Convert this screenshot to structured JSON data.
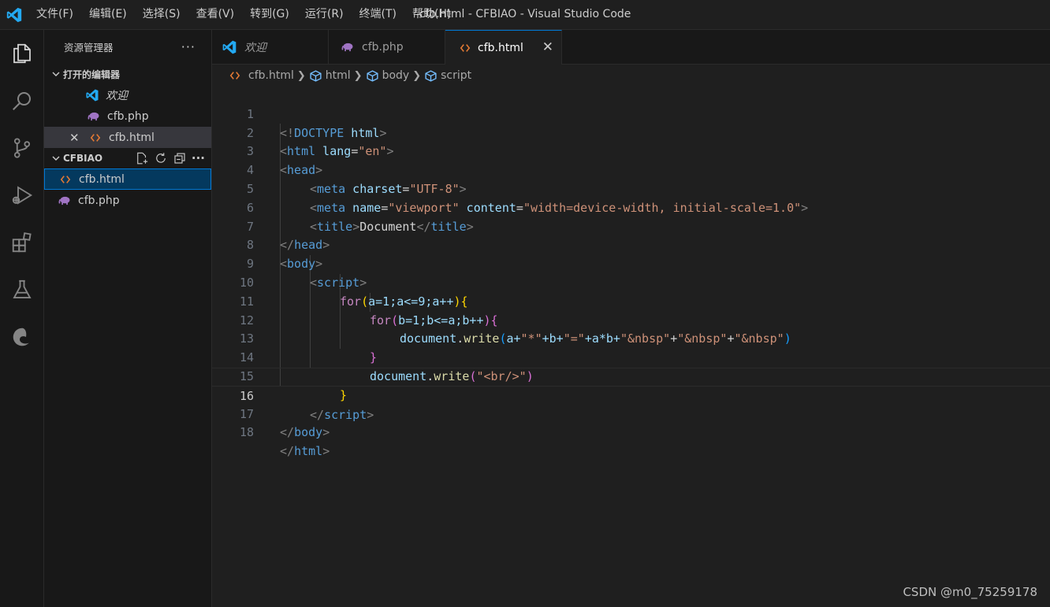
{
  "menu": [
    "文件(F)",
    "编辑(E)",
    "选择(S)",
    "查看(V)",
    "转到(G)",
    "运行(R)",
    "终端(T)",
    "帮助(H)"
  ],
  "window_title": "cfb.html - CFBIAO - Visual Studio Code",
  "sidebar": {
    "title": "资源管理器",
    "more": "···",
    "open_editors": {
      "label": "打开的编辑器",
      "items": [
        "欢迎",
        "cfb.php",
        "cfb.html"
      ]
    },
    "folder": {
      "label": "CFBIAO",
      "items": [
        "cfb.html",
        "cfb.php"
      ]
    }
  },
  "tabs": [
    "欢迎",
    "cfb.php",
    "cfb.html"
  ],
  "breadcrumb": [
    "cfb.html",
    "html",
    "body",
    "script"
  ],
  "line_numbers": [
    "1",
    "2",
    "3",
    "4",
    "5",
    "6",
    "7",
    "8",
    "9",
    "10",
    "11",
    "12",
    "13",
    "14",
    "15",
    "16",
    "17",
    "18"
  ],
  "code": {
    "l1": {
      "a": "<!",
      "b": "DOCTYPE",
      "c": " html",
      "d": ">"
    },
    "l2": {
      "a": "<",
      "b": "html",
      "c": " lang",
      "d": "=",
      "e": "\"en\"",
      "f": ">"
    },
    "l3": {
      "a": "<",
      "b": "head",
      "c": ">"
    },
    "l4": {
      "a": "<",
      "b": "meta",
      "c": " charset",
      "d": "=",
      "e": "\"UTF-8\"",
      "f": ">"
    },
    "l5": {
      "a": "<",
      "b": "meta",
      "c": " name",
      "d": "=",
      "e": "\"viewport\"",
      "f": " content",
      "g": "=",
      "h": "\"width=device-width, initial-scale=1.0\"",
      "i": ">"
    },
    "l6": {
      "a": "<",
      "b": "title",
      "c": ">",
      "d": "Document",
      "e": "</",
      "f": "title",
      "g": ">"
    },
    "l7": {
      "a": "</",
      "b": "head",
      "c": ">"
    },
    "l8": {
      "a": "<",
      "b": "body",
      "c": ">"
    },
    "l9": {
      "a": "<",
      "b": "script",
      "c": ">"
    },
    "l10": {
      "a": "for",
      "b": "(",
      "c": "a=1;a<=9;a++",
      "d": ")",
      "e": "{"
    },
    "l11": {
      "a": "for",
      "b": "(",
      "c": "b=1;b<=a;b++",
      "d": ")",
      "e": "{"
    },
    "l12": {
      "a": "document",
      "b": ".",
      "c": "write",
      "d": "(",
      "e": "a+",
      "f": "\"*\"",
      "g": "+b+",
      "h": "\"=\"",
      "i": "+a*b+",
      "j": "\"&nbsp\"",
      "k": "+",
      "l": "\"&nbsp\"",
      "m": "+",
      "n": "\"&nbsp\"",
      "o": ")"
    },
    "l13": {
      "a": "}"
    },
    "l14": {
      "a": "document",
      "b": ".",
      "c": "write",
      "d": "(",
      "e": "\"<br/>\"",
      "f": ")"
    },
    "l15": {
      "a": "}"
    },
    "l16": {
      "a": "</",
      "b": "script",
      "c": ">"
    },
    "l17": {
      "a": "</",
      "b": "body",
      "c": ">"
    },
    "l18": {
      "a": "</",
      "b": "html",
      "c": ">"
    }
  },
  "watermark": "CSDN @m0_75259178",
  "colors": {
    "accent": "#0078d4",
    "html_icon": "#e37933",
    "php_icon": "#a074c4",
    "vscode_icon": "#23a9f2"
  }
}
